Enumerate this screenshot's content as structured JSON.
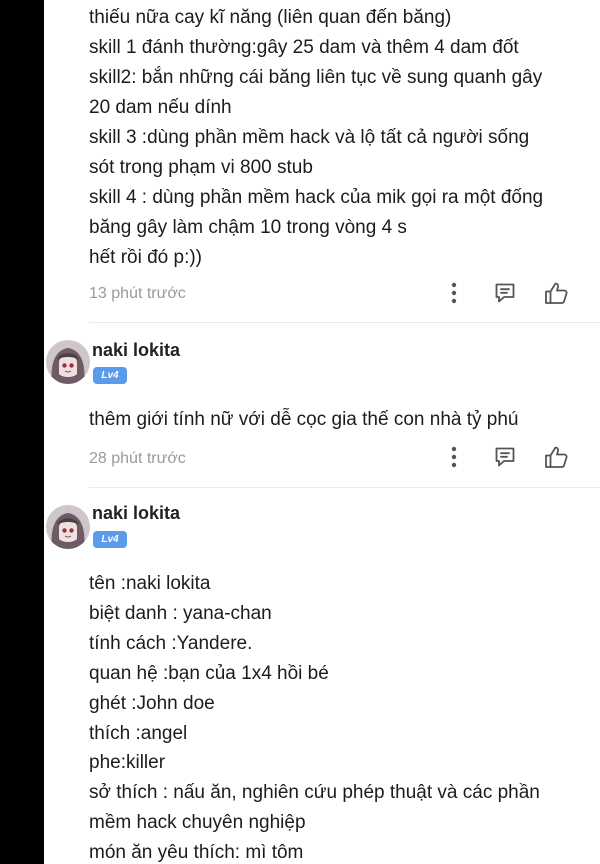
{
  "comment_1": {
    "lines": [
      "thiếu nữa cay  kĩ năng (liên quan đến băng)",
      "skill 1 đánh thường:gây 25 dam và thêm 4 dam đốt",
      "skill2: bắn những cái băng liên tục về sung quanh gây",
      "20 dam nếu dính",
      "skill 3 :dùng phần mềm hack và lộ tất cả người sống",
      "sót trong phạm vi 800 stub",
      "skill 4 : dùng phần mềm hack của mik gọi ra một đống",
      "băng gây làm chậm 10 trong vòng 4 s",
      "hết rồi đó p:))"
    ],
    "time": "13 phút trước",
    "more_icon": "more-vertical-icon",
    "reply_icon": "comment-icon",
    "like_icon": "thumbs-up-icon"
  },
  "comment_2": {
    "username": "naki lokita",
    "level": "Lv4",
    "text": "thêm giới tính nữ với dễ cọc gia thế con nhà tỷ phú",
    "time": "28 phút trước",
    "more_icon": "more-vertical-icon",
    "reply_icon": "comment-icon",
    "like_icon": "thumbs-up-icon"
  },
  "comment_3": {
    "username": "naki lokita",
    "level": "Lv4",
    "lines": [
      "tên :naki lokita",
      "biệt danh : yana-chan",
      "tính cách :Yandere.",
      "quan hệ :bạn của 1x4 hồi bé",
      "ghét :John doe",
      "thích :angel",
      "phe:killer",
      "sở thích : nấu ăn, nghiên cứu phép thuật và các phần",
      "mềm hack chuyên nghiệp",
      "món ăn yêu thích: mì tôm"
    ]
  },
  "colors": {
    "background": "#ffffff",
    "text": "#1c1c1c",
    "muted": "#9a9a9a",
    "badge": "#5a9bea",
    "icon": "#555555"
  }
}
